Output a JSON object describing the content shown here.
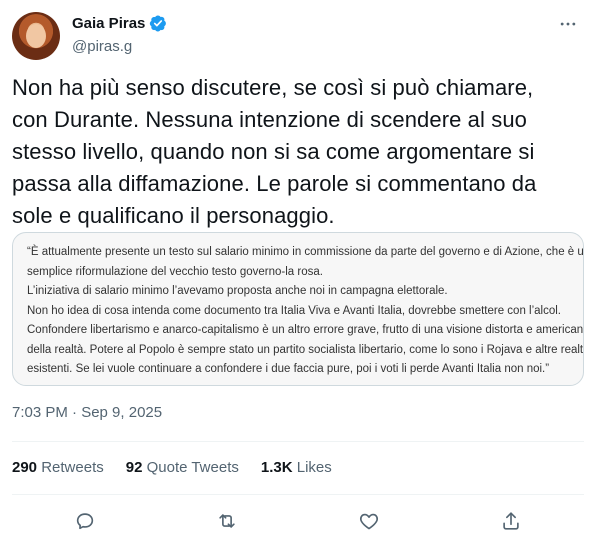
{
  "user": {
    "display_name": "Gaia Piras",
    "handle": "@piras.g",
    "verified": true
  },
  "icons": {
    "verified": "verified-badge-icon",
    "more": "more-icon",
    "reply": "reply-icon",
    "retweet": "retweet-icon",
    "like": "like-icon",
    "share": "share-icon"
  },
  "colors": {
    "verified": "#1d9bf0",
    "secondary_text": "#536471"
  },
  "tweet": {
    "text": "Non ha più senso discutere, se così si può chiamare, con Durante. Nessuna intenzione di scendere al suo stesso livello, quando non si sa come argomentare si passa alla diffamazione. Le parole si commentano da sole e qualificano il personaggio.",
    "timestamp": "7:03 PM · Sep 9, 2025"
  },
  "quote_image": {
    "lines": [
      "“È attualmente presente un testo sul salario minimo in commissione da parte del governo e di Azione, che è una",
      "semplice riformulazione del vecchio testo governo-la rosa.",
      "L’iniziativa di salario minimo l’avevamo proposta anche noi in campagna elettorale.",
      "Non ho idea di cosa intenda come documento tra Italia Viva e Avanti Italia, dovrebbe smettere con l’alcol.",
      "Confondere libertarismo e anarco-capitalismo è un altro errore grave, frutto di una visione distorta e americana",
      "della realtà. Potere al Popolo è sempre stato un partito socialista libertario, come lo sono i Rojava e altre realtà",
      "esistenti. Se lei vuole continuare a confondere i due faccia pure, poi i voti li perde Avanti Italia non noi.”"
    ]
  },
  "stats": {
    "retweets_count": "290",
    "retweets_label": "Retweets",
    "quotes_count": "92",
    "quotes_label": "Quote Tweets",
    "likes_count": "1.3K",
    "likes_label": "Likes"
  }
}
